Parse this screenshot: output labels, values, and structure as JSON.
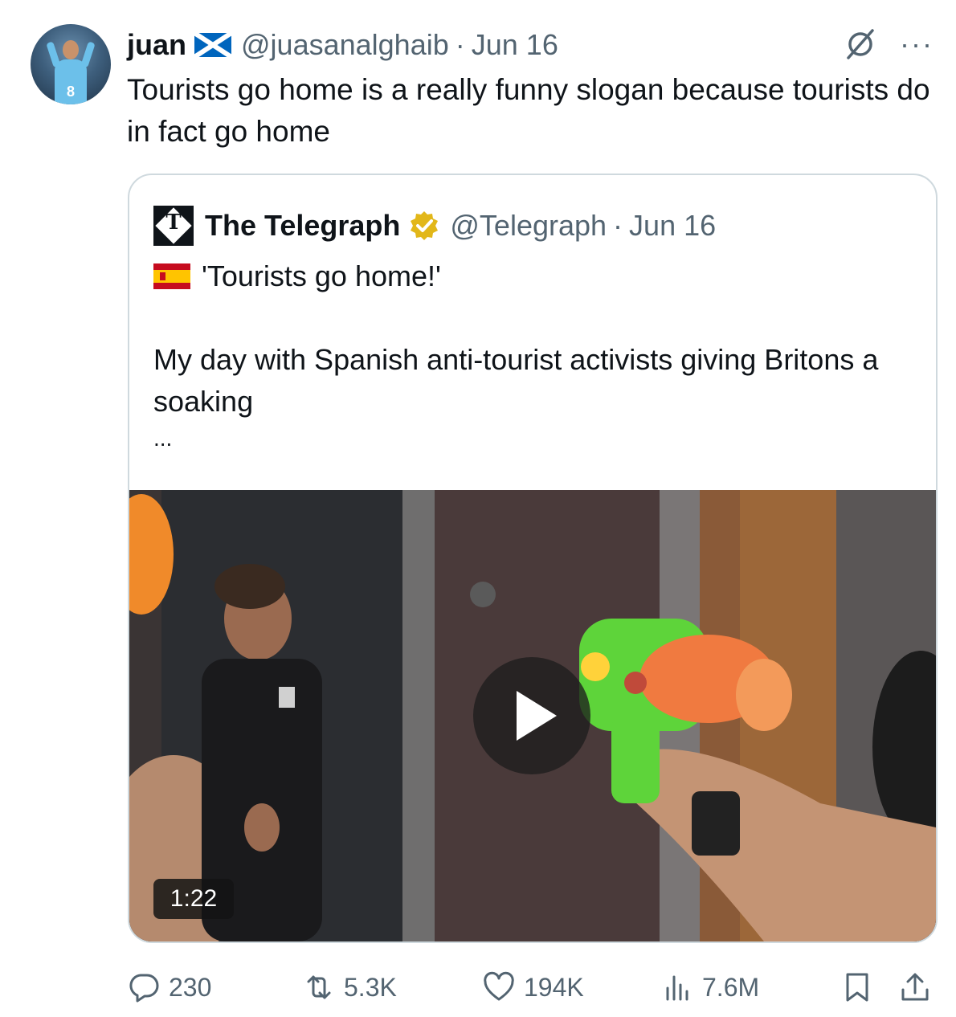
{
  "author": {
    "name": "juan",
    "flag_icon": "scotland-flag-icon",
    "handle": "@juasanalghaib",
    "separator": "·",
    "date": "Jun 16",
    "avatar_number": "8"
  },
  "tweet": {
    "text": "Tourists go home is a really funny slogan because tourists do in fact go home"
  },
  "top_icons": {
    "grok": "grok-icon",
    "more": "···"
  },
  "quote": {
    "name": "The Telegraph",
    "logo_letter": "T",
    "handle": "@Telegraph",
    "separator": "·",
    "date": "Jun 16",
    "verified_color": "#e2b719",
    "line1": "'Tourists go home!'",
    "line2": "My day with Spanish anti-tourist activists giving Britons a soaking",
    "ellipsis": "...",
    "video_duration": "1:22"
  },
  "actions": {
    "replies": "230",
    "reposts": "5.3K",
    "likes": "194K",
    "views": "7.6M"
  },
  "colors": {
    "text": "#0f1419",
    "secondary": "#536471",
    "border": "#cfd9de",
    "scotland_blue": "#0065bd",
    "spain_red": "#c60b1e",
    "spain_yellow": "#ffc400"
  }
}
